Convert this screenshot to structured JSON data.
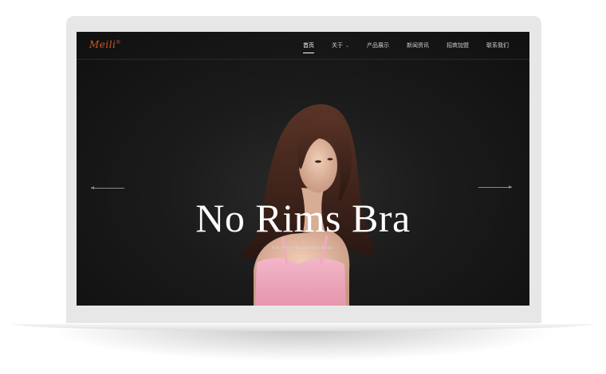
{
  "brand": {
    "logo_text": "Meili",
    "logo_mark": "®"
  },
  "nav": {
    "items": [
      {
        "label": "首页",
        "active": true
      },
      {
        "label": "关于",
        "has_dropdown": true
      },
      {
        "label": "产品展示"
      },
      {
        "label": "新闻资讯"
      },
      {
        "label": "招商加盟"
      },
      {
        "label": "联系我们"
      }
    ]
  },
  "hero": {
    "title": "No Rims Bra",
    "subtitle": "Fit Your Beautiful Bear"
  },
  "colors": {
    "screen_bg": "#121212",
    "logo": "#d35a24",
    "garment": "#f0a9c0"
  },
  "icons": {
    "prev": "arrow-left-icon",
    "next": "arrow-right-icon",
    "dropdown": "chevron-down-icon"
  }
}
